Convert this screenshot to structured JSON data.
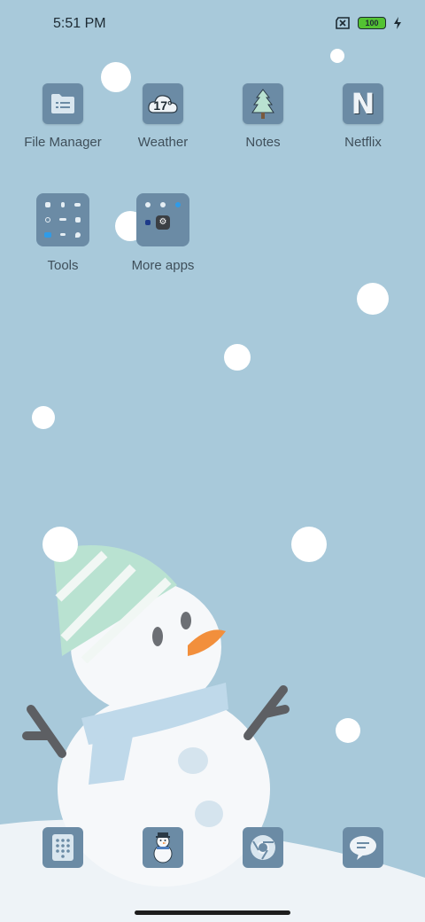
{
  "status_bar": {
    "time": "5:51 PM",
    "battery": "100"
  },
  "apps": [
    {
      "label": "File Manager"
    },
    {
      "label": "Weather",
      "badge": "17°"
    },
    {
      "label": "Notes"
    },
    {
      "label": "Netflix",
      "glyph": "N"
    }
  ],
  "folders": [
    {
      "label": "Tools"
    },
    {
      "label": "More apps"
    }
  ],
  "dock": [
    {
      "icon": "dialer-icon"
    },
    {
      "icon": "snowman-icon"
    },
    {
      "icon": "browser-icon"
    },
    {
      "icon": "messages-icon"
    }
  ],
  "colors": {
    "background": "#a8c9da",
    "icon_tile": "#6b8ba5",
    "battery_fill": "#53c233"
  }
}
